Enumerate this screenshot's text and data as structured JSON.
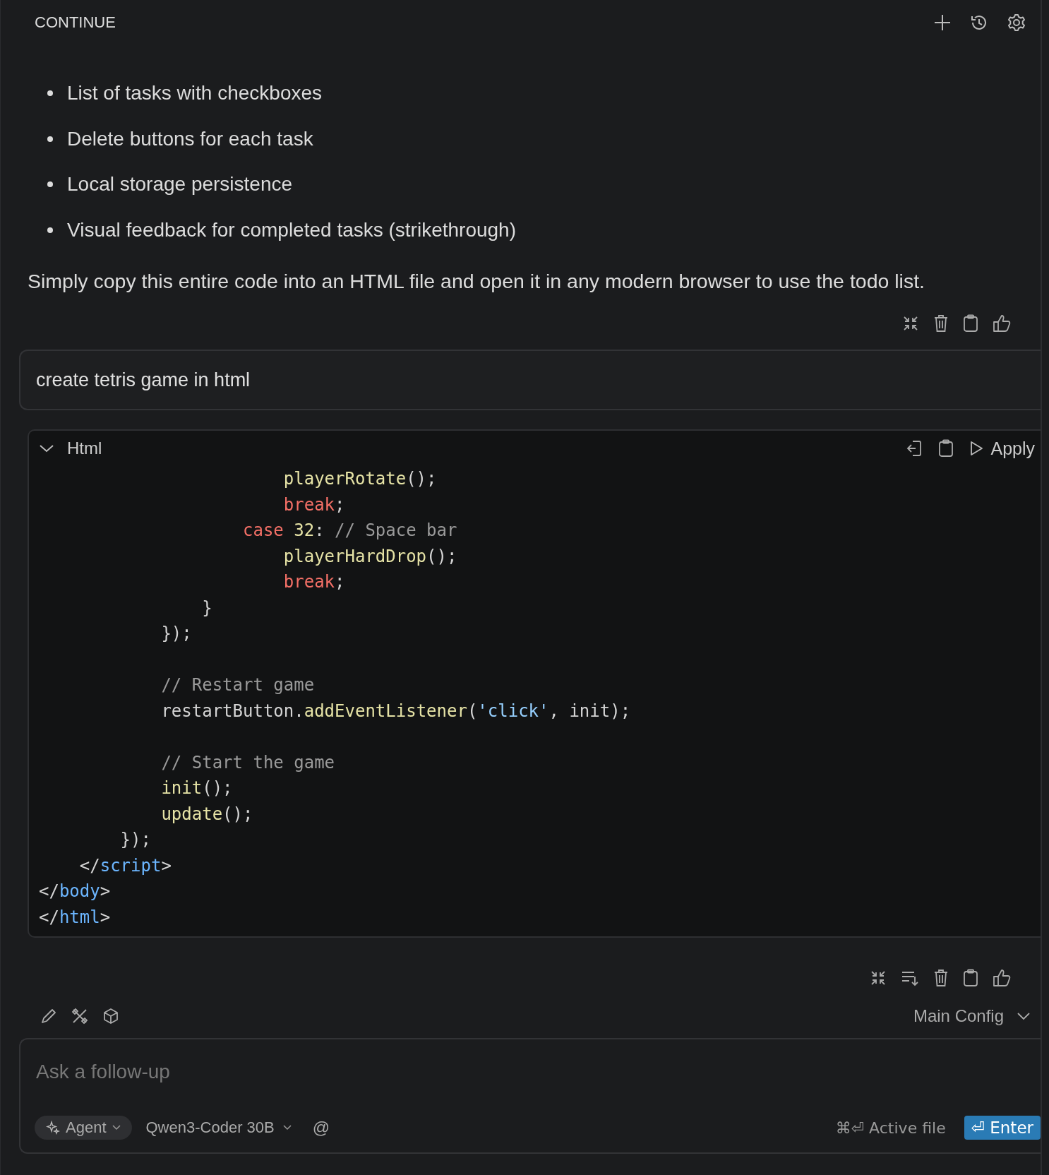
{
  "header": {
    "title": "CONTINUE"
  },
  "bullets": [
    "List of tasks with checkboxes",
    "Delete buttons for each task",
    "Local storage persistence",
    "Visual feedback for completed tasks (strikethrough)"
  ],
  "answer_text": "Simply copy this entire code into an HTML file and open it in any modern browser to use the todo list.",
  "user_message": "create tetris game in html",
  "code_block": {
    "language": "Html",
    "expanded": true,
    "apply_label": "Apply",
    "lines": [
      {
        "kind": "code",
        "tokens": [
          {
            "kind": "fn",
            "text": "                        playerRotate"
          },
          {
            "kind": "plain",
            "text": "();"
          }
        ]
      },
      {
        "kind": "code",
        "tokens": [
          {
            "kind": "kw",
            "text": "                        break"
          },
          {
            "kind": "plain",
            "text": ";"
          }
        ]
      },
      {
        "kind": "code",
        "tokens": [
          {
            "kind": "kw",
            "text": "                    case "
          },
          {
            "kind": "num",
            "text": "32"
          },
          {
            "kind": "plain",
            "text": ": "
          },
          {
            "kind": "comment",
            "text": "// Space bar"
          }
        ]
      },
      {
        "kind": "code",
        "tokens": [
          {
            "kind": "fn",
            "text": "                        playerHardDrop"
          },
          {
            "kind": "plain",
            "text": "();"
          }
        ]
      },
      {
        "kind": "code",
        "tokens": [
          {
            "kind": "kw",
            "text": "                        break"
          },
          {
            "kind": "plain",
            "text": ";"
          }
        ]
      },
      {
        "kind": "code",
        "tokens": [
          {
            "kind": "plain",
            "text": "                }"
          }
        ]
      },
      {
        "kind": "code",
        "tokens": [
          {
            "kind": "plain",
            "text": "            });"
          }
        ]
      },
      {
        "kind": "blank"
      },
      {
        "kind": "code",
        "tokens": [
          {
            "kind": "comment",
            "text": "            // Restart game"
          }
        ]
      },
      {
        "kind": "code",
        "tokens": [
          {
            "kind": "plain",
            "text": "            restartButton."
          },
          {
            "kind": "fn",
            "text": "addEventListener"
          },
          {
            "kind": "plain",
            "text": "("
          },
          {
            "kind": "string",
            "text": "'click'"
          },
          {
            "kind": "plain",
            "text": ", init);"
          }
        ]
      },
      {
        "kind": "blank"
      },
      {
        "kind": "code",
        "tokens": [
          {
            "kind": "comment",
            "text": "            // Start the game"
          }
        ]
      },
      {
        "kind": "code",
        "tokens": [
          {
            "kind": "fn",
            "text": "            init"
          },
          {
            "kind": "plain",
            "text": "();"
          }
        ]
      },
      {
        "kind": "code",
        "tokens": [
          {
            "kind": "fn",
            "text": "            update"
          },
          {
            "kind": "plain",
            "text": "();"
          }
        ]
      },
      {
        "kind": "code",
        "tokens": [
          {
            "kind": "plain",
            "text": "        });"
          }
        ]
      },
      {
        "kind": "code",
        "tokens": [
          {
            "kind": "plain",
            "text": "    </"
          },
          {
            "kind": "tag",
            "text": "script"
          },
          {
            "kind": "plain",
            "text": ">"
          }
        ]
      },
      {
        "kind": "code",
        "tokens": [
          {
            "kind": "plain",
            "text": "</"
          },
          {
            "kind": "tag",
            "text": "body"
          },
          {
            "kind": "plain",
            "text": ">"
          }
        ]
      },
      {
        "kind": "code",
        "tokens": [
          {
            "kind": "plain",
            "text": "</"
          },
          {
            "kind": "tag",
            "text": "html"
          },
          {
            "kind": "plain",
            "text": ">"
          }
        ]
      }
    ]
  },
  "config": {
    "label": "Main Config"
  },
  "input": {
    "placeholder": "Ask a follow-up"
  },
  "mode": {
    "label": "Agent"
  },
  "model": {
    "label": "Qwen3-Coder 30B"
  },
  "at_symbol": "@",
  "active_file": {
    "label": "⌘⏎ Active file"
  },
  "enter": {
    "label": "⏎ Enter"
  }
}
